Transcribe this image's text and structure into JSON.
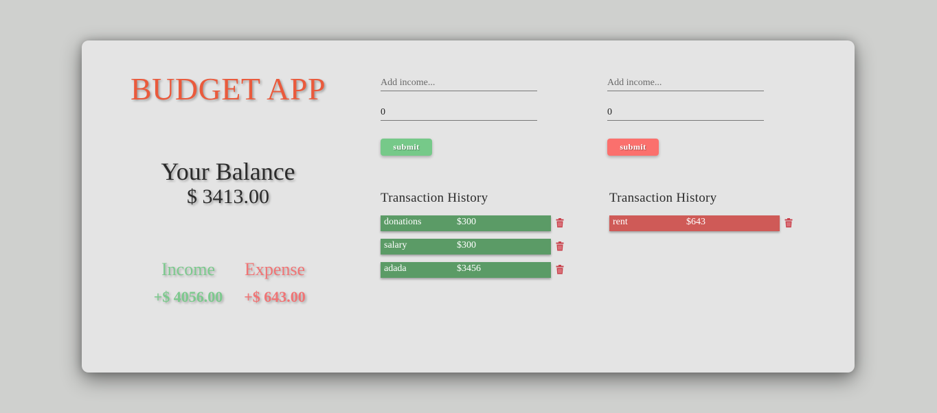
{
  "app": {
    "title": "BUDGET APP"
  },
  "balance": {
    "label": "Your Balance",
    "amount": "$ 3413.00"
  },
  "totals": {
    "income_label": "Income",
    "income_value": "+$ 4056.00",
    "expense_label": "Expense",
    "expense_value": "+$ 643.00"
  },
  "income_form": {
    "text_placeholder": "Add income...",
    "amount_value": "0",
    "submit_label": "submit"
  },
  "expense_form": {
    "text_placeholder": "Add income...",
    "amount_value": "0",
    "submit_label": "submit"
  },
  "income_history": {
    "title": "Transaction History",
    "items": [
      {
        "name": "donations",
        "amount": "$300"
      },
      {
        "name": "salary",
        "amount": "$300"
      },
      {
        "name": "adada",
        "amount": "$3456"
      }
    ]
  },
  "expense_history": {
    "title": "Transaction History",
    "items": [
      {
        "name": "rent",
        "amount": "$643"
      }
    ]
  },
  "colors": {
    "title": "#ea5a3c",
    "income": "#7cc98d",
    "expense": "#f07475",
    "income_row": "#5b9b66",
    "expense_row": "#cf5a57",
    "trash": "#c8414b"
  },
  "icons": {
    "delete": "trash-icon"
  }
}
